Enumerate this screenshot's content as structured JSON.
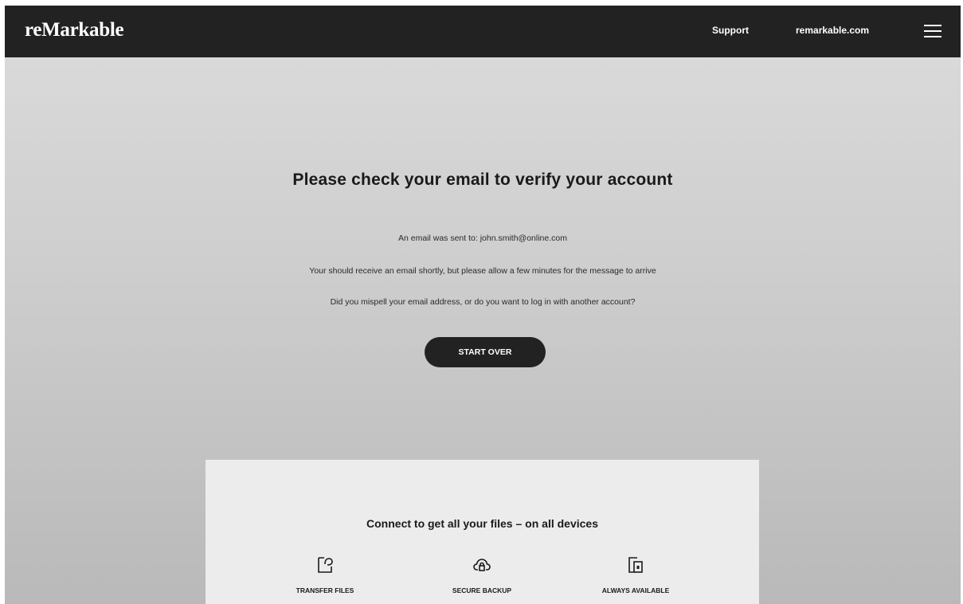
{
  "header": {
    "logo": "reMarkable",
    "nav": {
      "support": "Support",
      "site": "remarkable.com"
    },
    "menu_icon": "hamburger-menu-icon"
  },
  "main": {
    "headline": "Please check your email to verify your account",
    "sent_to": "An email was sent to: john.smith@online.com",
    "wait_note": "Your should receive an email shortly, but please allow a few minutes for the message to arrive",
    "misspell_note": "Did you mispell your email address, or do you want to log in with another account?",
    "start_over_label": "START OVER"
  },
  "panel": {
    "title": "Connect to get all your files – on all devices",
    "features": [
      {
        "icon": "transfer-files-icon",
        "label": "TRANSFER FILES"
      },
      {
        "icon": "secure-backup-icon",
        "label": "SECURE BACKUP"
      },
      {
        "icon": "always-available-icon",
        "label": "ALWAYS AVAILABLE"
      }
    ]
  },
  "colors": {
    "topbar": "#222222",
    "button": "#222222",
    "panel": "#ececec"
  }
}
